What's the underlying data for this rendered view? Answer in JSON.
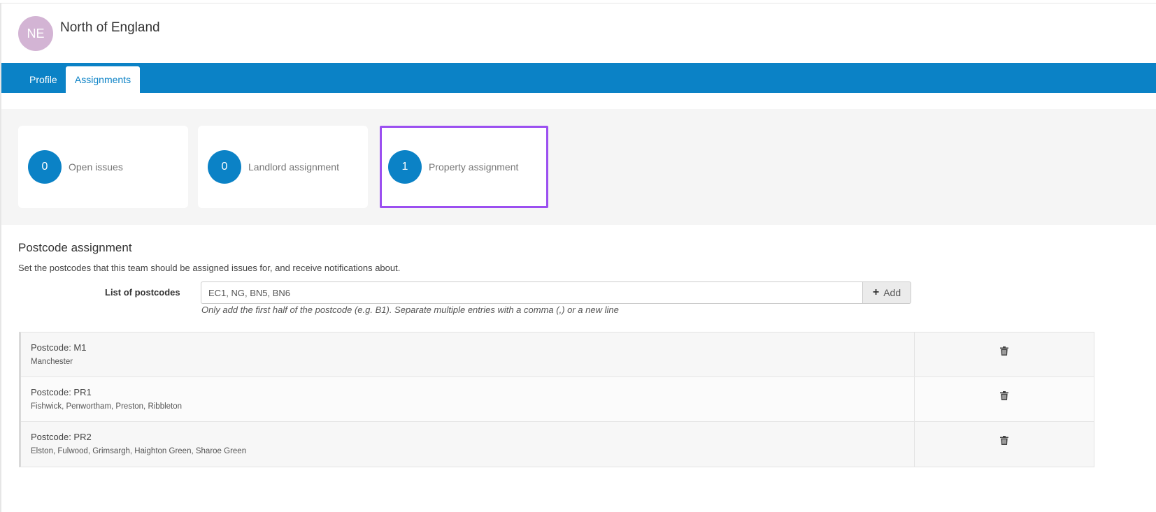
{
  "team": {
    "initials": "NE",
    "name": "North of England",
    "avatar_color": "#d3b4d4"
  },
  "tabs": [
    {
      "label": "Profile",
      "active": false
    },
    {
      "label": "Assignments",
      "active": true
    }
  ],
  "stats": [
    {
      "count": "0",
      "label": "Open issues"
    },
    {
      "count": "0",
      "label": "Landlord assignment"
    },
    {
      "count": "1",
      "label": "Property assignment",
      "highlighted": true
    }
  ],
  "postcode": {
    "title": "Postcode assignment",
    "description": "Set the postcodes that this team should be assigned issues for, and receive notifications about.",
    "field_label": "List of postcodes",
    "input_value": "EC1, NG, BN5, BN6",
    "add_label": "Add",
    "help": "Only add the first half of the postcode (e.g. B1). Separate multiple entries with a comma (,) or a new line"
  },
  "rows": [
    {
      "code": "Postcode: M1",
      "areas": "Manchester",
      "action_icon": "trash-icon"
    },
    {
      "code": "Postcode: PR1",
      "areas": "Fishwick, Penwortham, Preston, Ribbleton",
      "action_icon": "trash-icon"
    },
    {
      "code": "Postcode: PR2",
      "areas": "Elston, Fulwood, Grimsargh, Haighton Green, Sharoe Green",
      "action_icon": "trash-icon"
    }
  ],
  "colors": {
    "brand": "#0b82c6",
    "highlight_border": "#9b4ff0",
    "stats_band": "#f5f5f5"
  }
}
